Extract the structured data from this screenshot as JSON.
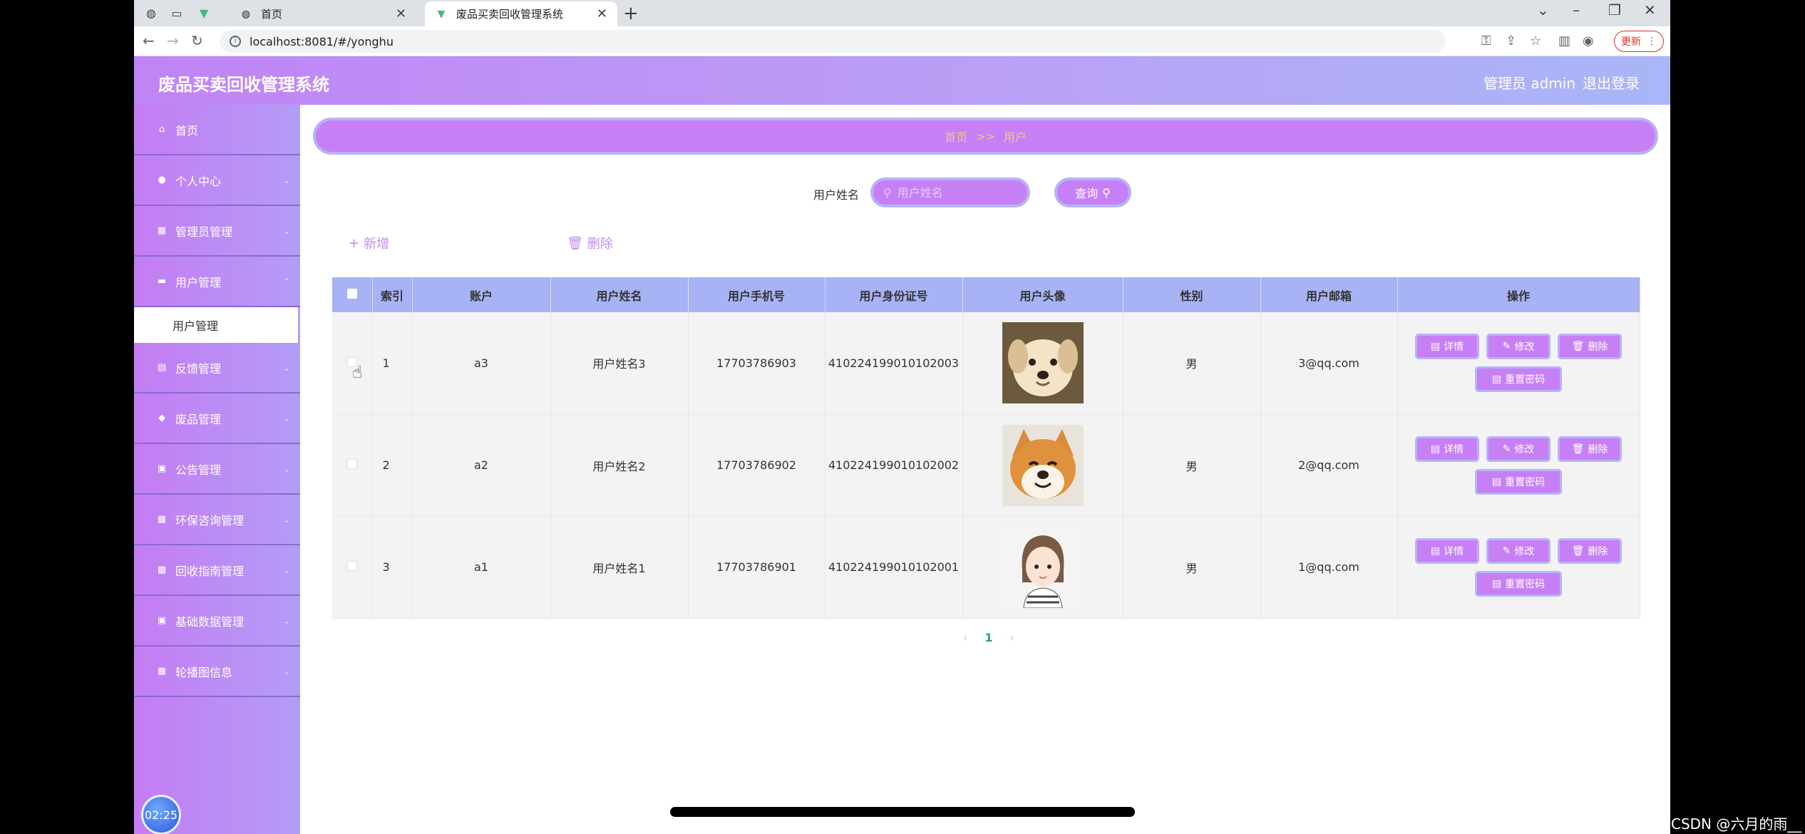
{
  "browser": {
    "tabs": [
      {
        "title": "首页"
      },
      {
        "title": "废品买卖回收管理系统"
      }
    ],
    "url": "localhost:8081/#/yonghu",
    "update_label": "更新"
  },
  "app": {
    "title": "废品买卖回收管理系统",
    "admin": "管理员 admin",
    "logout": "退出登录"
  },
  "sidebar": {
    "items": [
      {
        "label": "首页"
      },
      {
        "label": "个人中心"
      },
      {
        "label": "管理员管理"
      },
      {
        "label": "用户管理"
      },
      {
        "label": "反馈管理"
      },
      {
        "label": "废品管理"
      },
      {
        "label": "公告管理"
      },
      {
        "label": "环保咨询管理"
      },
      {
        "label": "回收指南管理"
      },
      {
        "label": "基础数据管理"
      },
      {
        "label": "轮播图信息"
      }
    ],
    "sub_item": "用户管理",
    "clock": "02:25"
  },
  "breadcrumb": {
    "home": "首页",
    "sep": ">>",
    "current": "用户"
  },
  "search": {
    "label": "用户姓名",
    "placeholder": "用户姓名",
    "button": "查询"
  },
  "actions": {
    "add": "新增",
    "delete": "删除"
  },
  "table": {
    "headers": [
      "索引",
      "账户",
      "用户姓名",
      "用户手机号",
      "用户身份证号",
      "用户头像",
      "性别",
      "用户邮箱",
      "操作"
    ],
    "rows": [
      {
        "index": "1",
        "account": "a3",
        "name": "用户姓名3",
        "phone": "17703786903",
        "id_card": "410224199010102003",
        "gender": "男",
        "email": "3@qq.com"
      },
      {
        "index": "2",
        "account": "a2",
        "name": "用户姓名2",
        "phone": "17703786902",
        "id_card": "410224199010102002",
        "gender": "男",
        "email": "2@qq.com"
      },
      {
        "index": "3",
        "account": "a1",
        "name": "用户姓名1",
        "phone": "17703786901",
        "id_card": "410224199010102001",
        "gender": "男",
        "email": "1@qq.com"
      }
    ],
    "ops": {
      "detail": "详情",
      "edit": "修改",
      "delete": "删除",
      "reset": "重置密码"
    }
  },
  "pagination": {
    "current": "1"
  },
  "watermark": "CSDN @六月的雨__",
  "colors": {
    "accent": "#c77ff5",
    "border": "#b7b3f7",
    "header_bg": "#a7b3f5",
    "breadcrumb_text": "#f6c77c"
  }
}
